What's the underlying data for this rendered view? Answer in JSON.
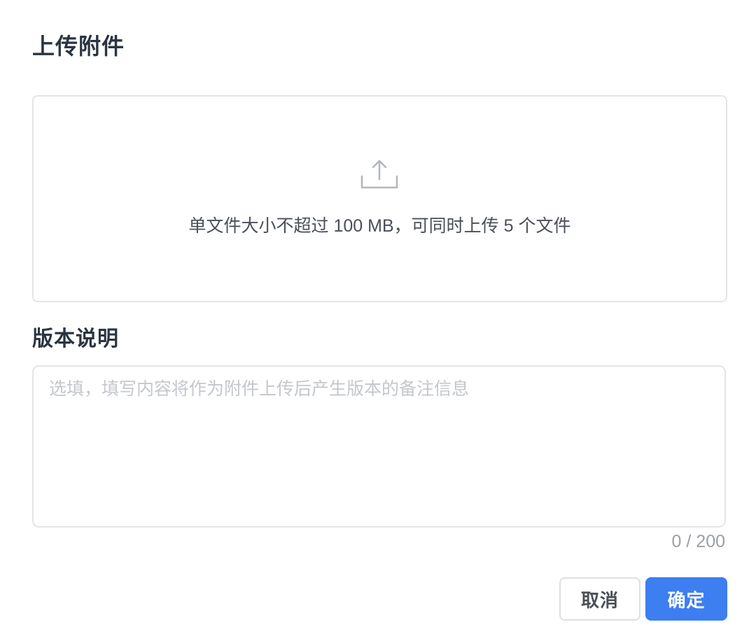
{
  "dialog": {
    "title": "上传附件"
  },
  "upload": {
    "icon": "upload-icon",
    "hint": "单文件大小不超过 100 MB，可同时上传 5 个文件"
  },
  "version_note": {
    "label": "版本说明",
    "value": "",
    "placeholder": "选填，填写内容将作为附件上传后产生版本的备注信息",
    "counter": "0 / 200"
  },
  "footer": {
    "cancel_label": "取消",
    "confirm_label": "确定"
  },
  "colors": {
    "primary": "#3d7ef0",
    "border": "#e3e5e8",
    "title": "#2b3441",
    "placeholder": "#c4c7cc"
  }
}
